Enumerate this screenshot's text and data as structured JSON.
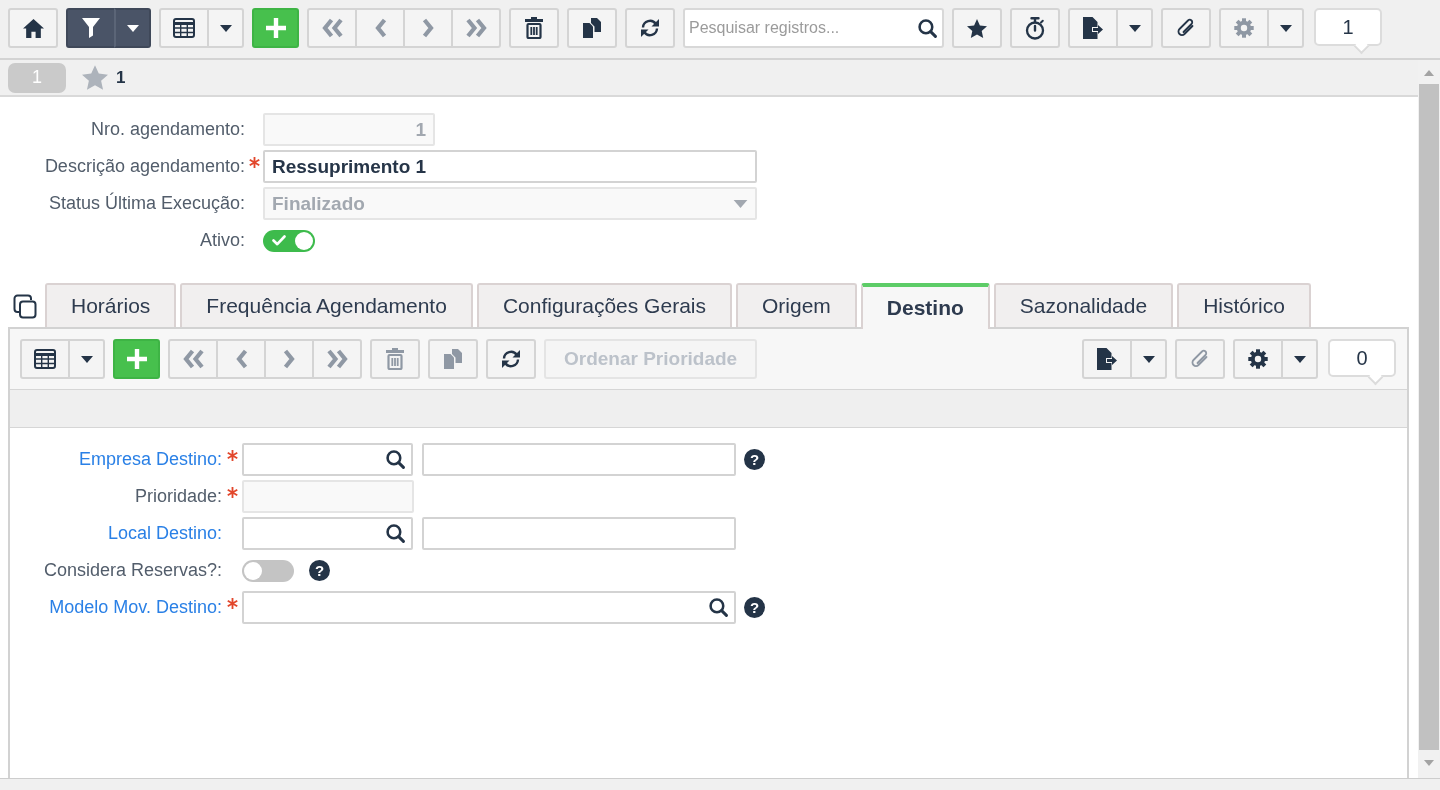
{
  "toolbar": {
    "left": [
      {
        "kind": "group",
        "buttons": [
          {
            "kind": "home",
            "disabled": false,
            "active": false
          }
        ]
      },
      {
        "kind": "group",
        "buttons": [
          {
            "kind": "filter",
            "disabled": false,
            "active": true
          },
          {
            "kind": "caret",
            "disabled": false,
            "active": true
          }
        ]
      },
      {
        "kind": "group",
        "buttons": [
          {
            "kind": "grid",
            "disabled": false,
            "active": false
          },
          {
            "kind": "caret",
            "disabled": false,
            "active": false
          }
        ]
      },
      {
        "kind": "group",
        "buttons": [
          {
            "kind": "add",
            "disabled": false,
            "active": false
          }
        ]
      },
      {
        "kind": "group",
        "buttons": [
          {
            "kind": "first",
            "disabled": true,
            "active": false
          },
          {
            "kind": "previous",
            "disabled": true,
            "active": false
          },
          {
            "kind": "next",
            "disabled": true,
            "active": false
          },
          {
            "kind": "last",
            "disabled": true,
            "active": false
          }
        ]
      },
      {
        "kind": "group",
        "buttons": [
          {
            "kind": "delete",
            "disabled": false,
            "active": false
          }
        ]
      },
      {
        "kind": "group",
        "buttons": [
          {
            "kind": "copy",
            "disabled": false,
            "active": false
          }
        ]
      },
      {
        "kind": "group",
        "buttons": [
          {
            "kind": "refresh",
            "disabled": false,
            "active": false
          }
        ]
      },
      {
        "kind": "search",
        "placeholder": "Pesquisar registros..."
      },
      {
        "kind": "group",
        "buttons": [
          {
            "kind": "favorite",
            "disabled": false,
            "active": false
          }
        ]
      },
      {
        "kind": "group",
        "buttons": [
          {
            "kind": "timer",
            "disabled": false,
            "active": false
          }
        ]
      },
      {
        "kind": "group",
        "buttons": [
          {
            "kind": "export",
            "disabled": false,
            "active": false
          },
          {
            "kind": "caret",
            "disabled": false,
            "active": false
          }
        ]
      },
      {
        "kind": "group",
        "buttons": [
          {
            "kind": "attach",
            "disabled": false,
            "active": false
          }
        ]
      },
      {
        "kind": "group",
        "buttons": [
          {
            "kind": "settings",
            "disabled": true,
            "active": false
          },
          {
            "kind": "caret",
            "disabled": false,
            "active": false
          }
        ]
      }
    ],
    "record_count": "1"
  },
  "record_bar": {
    "record_tab": "1",
    "favorites": "1"
  },
  "form": {
    "fields": [
      {
        "kind": "number",
        "label": "Nro. agendamento:",
        "value": "1",
        "required": false,
        "disabled": true
      },
      {
        "kind": "text",
        "label": "Descrição agendamento:",
        "value": "Ressuprimento 1",
        "required": true,
        "disabled": false
      },
      {
        "kind": "select",
        "label": "Status Última Execução:",
        "value": "Finalizado",
        "required": false,
        "disabled": true
      },
      {
        "kind": "toggle",
        "label": "Ativo:",
        "on": true,
        "required": false,
        "disabled": false
      }
    ]
  },
  "tabs": [
    {
      "label": "Horários",
      "selected": false
    },
    {
      "label": "Frequência Agendamento",
      "selected": false
    },
    {
      "label": "Configurações Gerais",
      "selected": false
    },
    {
      "label": "Origem",
      "selected": false
    },
    {
      "label": "Destino",
      "selected": true
    },
    {
      "label": "Sazonalidade",
      "selected": false
    },
    {
      "label": "Histórico",
      "selected": false
    }
  ],
  "detail": {
    "toolbar": {
      "left": [
        {
          "kind": "group",
          "buttons": [
            {
              "kind": "grid",
              "disabled": false,
              "active": false
            },
            {
              "kind": "caret",
              "disabled": false,
              "active": false
            }
          ]
        },
        {
          "kind": "group",
          "buttons": [
            {
              "kind": "add",
              "disabled": false,
              "active": false
            }
          ]
        },
        {
          "kind": "group",
          "buttons": [
            {
              "kind": "first",
              "disabled": true,
              "active": false
            },
            {
              "kind": "previous",
              "disabled": true,
              "active": false
            },
            {
              "kind": "next",
              "disabled": true,
              "active": false
            },
            {
              "kind": "last",
              "disabled": true,
              "active": false
            }
          ]
        },
        {
          "kind": "group",
          "buttons": [
            {
              "kind": "delete",
              "disabled": true,
              "active": false
            }
          ]
        },
        {
          "kind": "group",
          "buttons": [
            {
              "kind": "copy",
              "disabled": true,
              "active": false
            }
          ]
        },
        {
          "kind": "group",
          "buttons": [
            {
              "kind": "refresh",
              "disabled": false,
              "active": false
            }
          ]
        },
        {
          "kind": "action",
          "label": "Ordenar Prioridade",
          "disabled": true
        }
      ],
      "right": [
        {
          "kind": "group",
          "buttons": [
            {
              "kind": "export",
              "disabled": false,
              "active": false
            },
            {
              "kind": "caret",
              "disabled": false,
              "active": false
            }
          ]
        },
        {
          "kind": "group",
          "buttons": [
            {
              "kind": "attach",
              "disabled": true,
              "active": false
            }
          ]
        },
        {
          "kind": "group",
          "buttons": [
            {
              "kind": "settings",
              "disabled": false,
              "active": false
            },
            {
              "kind": "caret",
              "disabled": false,
              "active": false
            }
          ]
        }
      ],
      "record_count": "0"
    },
    "fields": [
      {
        "kind": "lookup",
        "label": "Empresa Destino:",
        "link": true,
        "required": true,
        "disabled": false,
        "help": "?"
      },
      {
        "kind": "number",
        "label": "Prioridade:",
        "link": false,
        "required": true,
        "disabled": true
      },
      {
        "kind": "lookup",
        "label": "Local Destino:",
        "link": true,
        "required": false,
        "disabled": false
      },
      {
        "kind": "toggle",
        "label": "Considera Reservas?:",
        "link": false,
        "required": false,
        "disabled": false,
        "on": false,
        "help": "?"
      },
      {
        "kind": "lookup_wide",
        "label": "Modelo Mov. Destino:",
        "link": true,
        "required": true,
        "disabled": false,
        "help": "?"
      }
    ]
  }
}
